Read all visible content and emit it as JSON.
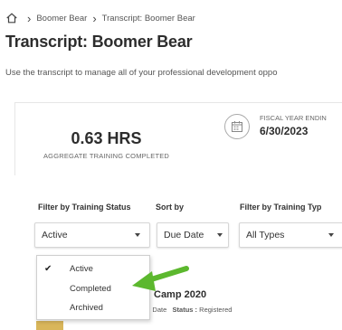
{
  "breadcrumb": {
    "items": [
      "Boomer Bear",
      "Transcript: Boomer Bear"
    ]
  },
  "page": {
    "title": "Transcript: Boomer Bear",
    "subtitle": "Use the transcript to manage all of your professional development oppo"
  },
  "summary": {
    "hours_value": "0.63 HRS",
    "hours_label": "AGGREGATE TRAINING COMPLETED",
    "fiscal_label": "FISCAL YEAR ENDIN",
    "fiscal_date": "6/30/2023"
  },
  "filters": {
    "status_label": "Filter by Training Status",
    "status_value": "Active",
    "sort_label": "Sort by",
    "sort_value": "Due Date",
    "type_label": "Filter by Training Typ",
    "type_value": "All Types",
    "status_options": [
      {
        "label": "Active",
        "checked": true
      },
      {
        "label": "Completed",
        "checked": false
      },
      {
        "label": "Archived",
        "checked": false
      }
    ]
  },
  "list_item": {
    "title": "Camp 2020",
    "due_label": "ue Date",
    "status_key": "Status :",
    "status_value": "Registered"
  },
  "colors": {
    "annotation_arrow": "#5cb82e",
    "thumb": "#d9b65a"
  }
}
